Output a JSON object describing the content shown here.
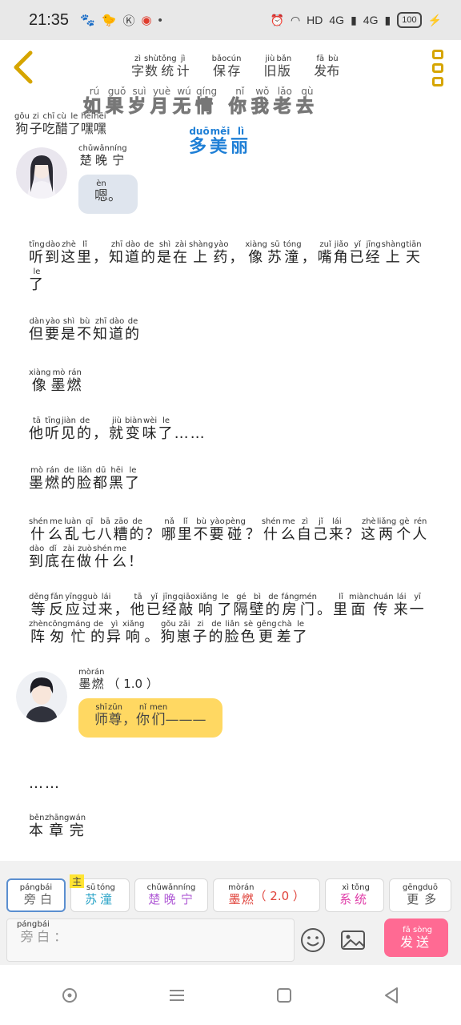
{
  "status_bar": {
    "time": "21:35",
    "network": "HD",
    "signal1": "4G",
    "signal2": "4G",
    "battery": "100"
  },
  "topbar": {
    "nav": [
      {
        "pinyin": [
          "zì",
          "shù",
          "tǒng",
          "jì"
        ],
        "chars": [
          "字",
          "数",
          "统",
          "计"
        ]
      },
      {
        "pinyin": [
          "bǎo",
          "cún"
        ],
        "chars": [
          "保",
          "存"
        ]
      },
      {
        "pinyin": [
          "jiù",
          "bǎn"
        ],
        "chars": [
          "旧",
          "版"
        ]
      },
      {
        "pinyin": [
          "fā",
          "bù"
        ],
        "chars": [
          "发",
          "布"
        ]
      }
    ]
  },
  "overlay_title": {
    "pinyin": [
      "rú",
      "guǒ",
      "suì",
      "yuè",
      "wú",
      "qíng",
      "",
      "nǐ",
      "wǒ",
      "lǎo",
      "qù"
    ],
    "chars": [
      "如",
      "果",
      "岁",
      "月",
      "无",
      "情",
      " ",
      "你",
      "我",
      "老",
      "去"
    ]
  },
  "sub_title": {
    "pinyin": [
      "duō",
      "měi",
      "lì"
    ],
    "chars": [
      "多",
      "美",
      "丽"
    ]
  },
  "book_title": {
    "pinyin": [
      "gǒu",
      "zi",
      "chī",
      "cù",
      "le",
      "hēi",
      "hēi"
    ],
    "chars": [
      "狗",
      "子",
      "吃",
      "醋",
      "了",
      "嘿",
      "嘿"
    ]
  },
  "messages": [
    {
      "speaker_pinyin": [
        "chǔ",
        "wǎn",
        "níng"
      ],
      "speaker": [
        "楚",
        "晚",
        "宁"
      ],
      "text_pinyin": [
        "èn",
        ""
      ],
      "text": [
        "嗯",
        "。"
      ]
    },
    {
      "speaker_pinyin": [
        "mò",
        "rán"
      ],
      "speaker": [
        "墨",
        "燃"
      ],
      "speaker_suffix": "（ 1.0 ）",
      "text_pinyin": [
        "shī",
        "zūn",
        "",
        "nǐ",
        "men"
      ],
      "text": [
        "师",
        "尊",
        "，",
        "你",
        "们"
      ],
      "text_tail": "———"
    }
  ],
  "narration": [
    {
      "pinyin": [
        "tīng",
        "dào",
        "zhè",
        "lǐ",
        "",
        "zhī",
        "dào",
        "de",
        "shì",
        "zài",
        "shàng",
        "yào",
        "",
        "xiàng",
        "sū",
        "tóng",
        "",
        "zuǐ",
        "jiǎo",
        "yǐ",
        "jīng",
        "shàng",
        "tiān",
        "le"
      ],
      "chars": [
        "听",
        "到",
        "这",
        "里",
        "，",
        "知",
        "道",
        "的",
        "是",
        "在",
        "上",
        "药",
        "，",
        "像",
        "苏",
        "潼",
        "，",
        "嘴",
        "角",
        "已",
        "经",
        "上",
        "天",
        "了"
      ]
    },
    {
      "pinyin": [
        "dàn",
        "yào",
        "shì",
        "bù",
        "zhī",
        "dào",
        "de"
      ],
      "chars": [
        "但",
        "要",
        "是",
        "不",
        "知",
        "道",
        "的"
      ]
    },
    {
      "pinyin": [
        "xiàng",
        "mò",
        "rán"
      ],
      "chars": [
        "像",
        "墨",
        "燃"
      ]
    },
    {
      "pinyin": [
        "tā",
        "tīng",
        "jiàn",
        "de",
        "",
        "jiù",
        "biàn",
        "wèi",
        "le",
        ""
      ],
      "chars": [
        "他",
        "听",
        "见",
        "的",
        "，",
        "就",
        "变",
        "味",
        "了",
        "……"
      ]
    },
    {
      "pinyin": [
        "mò",
        "rán",
        "de",
        "liǎn",
        "dū",
        "hēi",
        "le"
      ],
      "chars": [
        "墨",
        "燃",
        "的",
        "脸",
        "都",
        "黑",
        "了"
      ]
    },
    {
      "pinyin": [
        "shén",
        "me",
        "luàn",
        "qī",
        "bā",
        "zāo",
        "de",
        "",
        "nǎ",
        "lǐ",
        "bù",
        "yào",
        "pèng",
        "",
        "shén",
        "me",
        "zì",
        "jǐ",
        "lái",
        "",
        "zhè",
        "liǎng",
        "gè",
        "rén",
        "dào",
        "dǐ",
        "zài",
        "zuò",
        "shén",
        "me",
        ""
      ],
      "chars": [
        "什",
        "么",
        "乱",
        "七",
        "八",
        "糟",
        "的",
        "？",
        "哪",
        "里",
        "不",
        "要",
        "碰",
        "？",
        "什",
        "么",
        "自",
        "己",
        "来",
        "？",
        "这",
        "两",
        "个",
        "人",
        "到",
        "底",
        "在",
        "做",
        "什",
        "么",
        "！"
      ]
    },
    {
      "pinyin": [
        "děng",
        "fǎn",
        "yīng",
        "guò",
        "lái",
        "",
        "tā",
        "yǐ",
        "jīng",
        "qiāo",
        "xiǎng",
        "le",
        "gé",
        "bì",
        "de",
        "fáng",
        "mén",
        "",
        "lǐ",
        "miàn",
        "chuán",
        "lái",
        "yī",
        "zhèn",
        "cōng",
        "máng",
        "de",
        "yì",
        "xiǎng",
        "",
        "gǒu",
        "zǎi",
        "zi",
        "de",
        "liǎn",
        "sè",
        "gēng",
        "chà",
        "le"
      ],
      "chars": [
        "等",
        "反",
        "应",
        "过",
        "来",
        "，",
        "他",
        "已",
        "经",
        "敲",
        "响",
        "了",
        "隔",
        "壁",
        "的",
        "房",
        "门",
        "。",
        "里",
        "面",
        "传",
        "来",
        "一",
        "阵",
        "匆",
        "忙",
        "的",
        "异",
        "响",
        "。",
        "狗",
        "崽",
        "子",
        "的",
        "脸",
        "色",
        "更",
        "差",
        "了"
      ]
    },
    {
      "pinyin": [
        ""
      ],
      "chars": [
        "……"
      ]
    },
    {
      "pinyin": [
        "běn",
        "zhāng",
        "wán"
      ],
      "chars": [
        "本",
        "章",
        "完"
      ]
    }
  ],
  "roles": [
    {
      "pinyin": [
        "páng",
        "bái"
      ],
      "chars": [
        "旁",
        "白"
      ],
      "color": "#666666",
      "active": true
    },
    {
      "badge_pinyin": "zhǔ",
      "badge": "主",
      "pinyin": [
        "sū",
        "tóng"
      ],
      "chars": [
        "苏",
        "潼"
      ],
      "color": "#29a3c7"
    },
    {
      "pinyin": [
        "chǔ",
        "wǎn",
        "níng"
      ],
      "chars": [
        "楚",
        "晚",
        "宁"
      ],
      "color": "#b05cd6"
    },
    {
      "pinyin": [
        "mò",
        "rán"
      ],
      "chars": [
        "墨",
        "燃"
      ],
      "suffix": "（ 2.0 ）",
      "color": "#e0443c"
    },
    {
      "pinyin": [
        "xì",
        "tǒng"
      ],
      "chars": [
        "系",
        "统"
      ],
      "color": "#e03ca8"
    },
    {
      "pinyin": [
        "gēng",
        "duō"
      ],
      "chars": [
        "更",
        "多"
      ],
      "color": "#555555"
    }
  ],
  "input": {
    "label_pinyin": [
      "páng",
      "bái"
    ],
    "label": [
      "旁",
      "白"
    ],
    "colon": "："
  },
  "send": {
    "pinyin": [
      "fā",
      "sòng"
    ],
    "chars": [
      "发",
      "送"
    ]
  },
  "colors": {
    "accent_yellow": "#ffd862",
    "send_pink": "#ff6a93",
    "title_blue": "#1e7fd6",
    "menu_gold": "#d6a500"
  },
  "icons": [
    "back-arrow-icon",
    "menu-dots-icon",
    "emoji-icon",
    "image-icon",
    "home-circle-icon",
    "recents-lines-icon",
    "square-icon",
    "triangle-back-icon"
  ]
}
